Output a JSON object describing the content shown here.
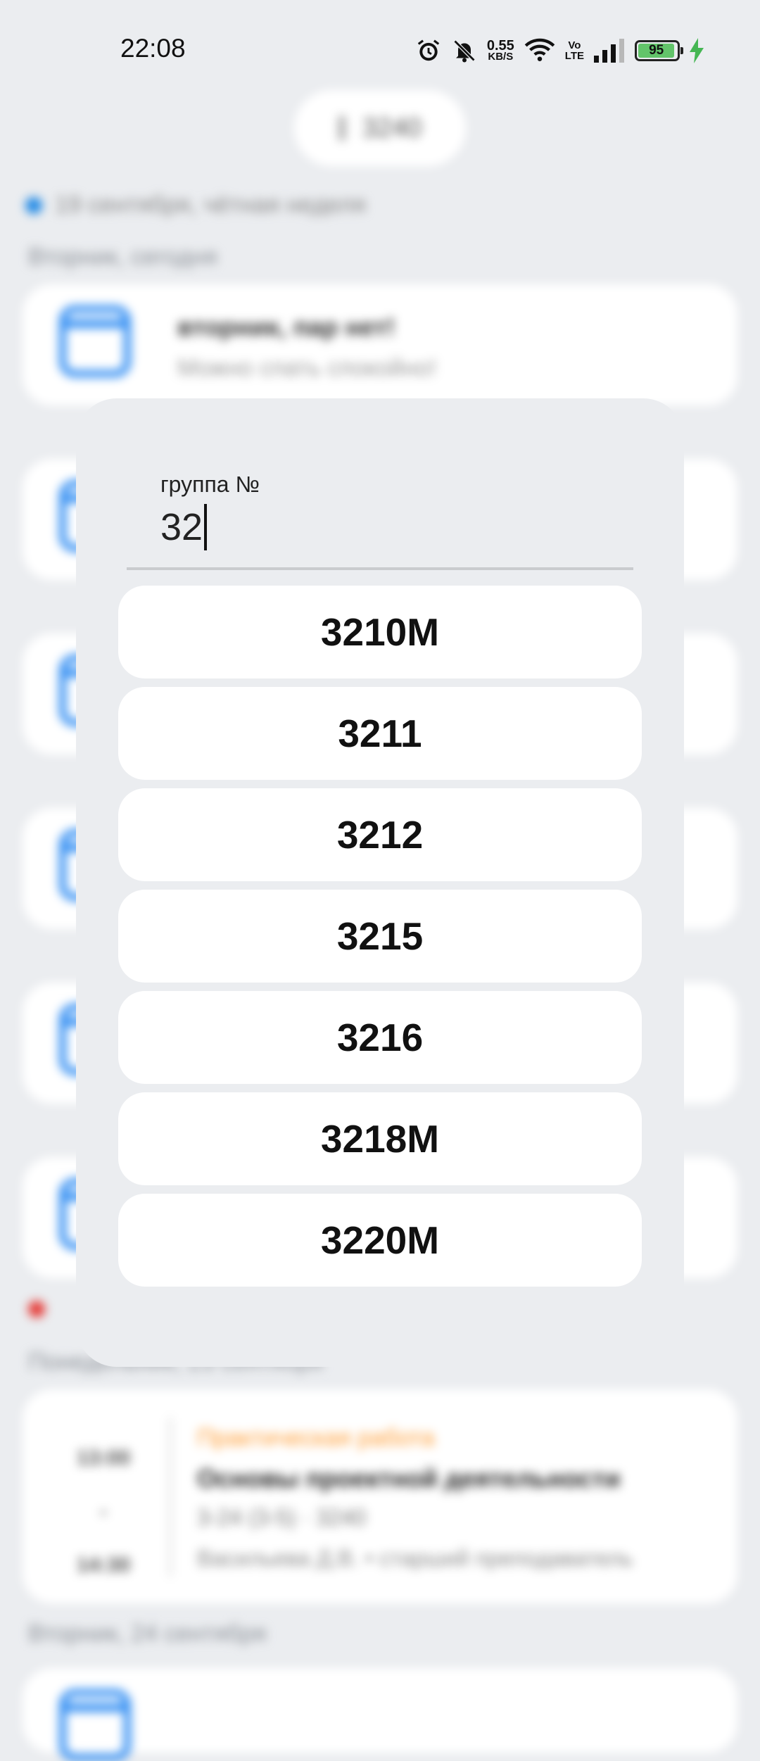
{
  "status_bar": {
    "time": "22:08",
    "icons": [
      "alarm-icon",
      "mute-icon",
      "wifi-icon",
      "signal-icon",
      "battery-icon",
      "charging-icon"
    ],
    "net_speed_value": "0.55",
    "net_speed_unit": "KB/S",
    "volte_top": "Vo",
    "volte_bottom": "LTE",
    "battery_level": "95"
  },
  "background": {
    "week_text": "19 сентября, чётная неделя",
    "day_label_1": "Вторник, сегодня",
    "empty_card_title": "вторник, пар нет!",
    "empty_card_sub": "Можно спать спокойно!",
    "day_label_2": "Понедельник, 23 сентября",
    "lesson": {
      "time_start": "13:00",
      "time_sep": "-",
      "time_end": "14:30",
      "type": "Практическая работа",
      "name": "Основы проектной деятельности",
      "room": "3-24 (3-5) · 3240",
      "teacher": "Васильева Д.В. • старший преподаватель"
    },
    "day_label_3": "Вторник, 24 сентября",
    "pill_text": "3240",
    "accent_blue": "#1e88e5",
    "accent_orange": "#ff9a2f"
  },
  "dialog": {
    "field_label": "группа №",
    "field_value": "32",
    "groups": [
      "3210M",
      "3211",
      "3212",
      "3215",
      "3216",
      "3218M",
      "3220M",
      ""
    ]
  }
}
